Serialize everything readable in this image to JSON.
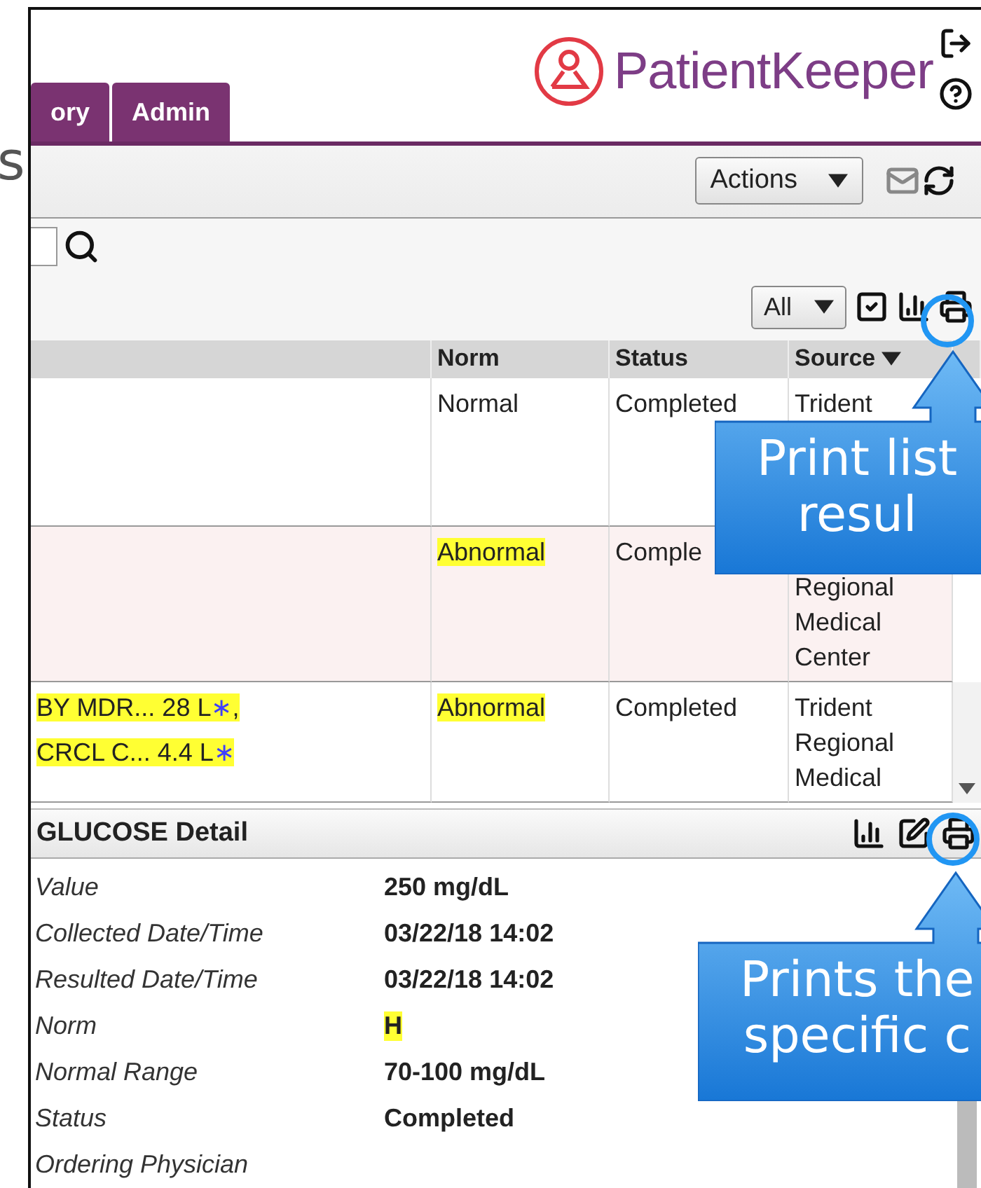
{
  "side_letter": "s",
  "header": {
    "logo": "PatientKeeper",
    "tabs": [
      {
        "label": "ory",
        "selected": false
      },
      {
        "label": "Admin",
        "selected": false
      }
    ]
  },
  "toolbar": {
    "actions": "Actions"
  },
  "filter": {
    "value": "All"
  },
  "table": {
    "columns": [
      {
        "label": "Norm",
        "sorted": false
      },
      {
        "label": "Status",
        "sorted": false
      },
      {
        "label": "Source",
        "sorted": true
      }
    ],
    "rows": [
      {
        "results": [],
        "norm": "Normal",
        "abnormal": false,
        "status": "Completed",
        "source": [
          "Trident"
        ],
        "shaded": false
      },
      {
        "results": [],
        "norm": "Abnormal",
        "abnormal": true,
        "status": "Comple",
        "source": [
          "Regional",
          "Medical",
          "Center"
        ],
        "source_covered": true,
        "shaded": true
      },
      {
        "results": [
          {
            "text": "BY MDR... 28 L",
            "flag": "∗",
            "sep": ","
          },
          {
            "text": "CRCL C... 4.4 L",
            "flag": "∗"
          }
        ],
        "norm": "Abnormal",
        "abnormal": true,
        "status": "Completed",
        "source": [
          "Trident",
          "Regional",
          "Medical"
        ],
        "shaded": false
      }
    ]
  },
  "detail": {
    "title": "GLUCOSE Detail",
    "fields": [
      {
        "label": "Value",
        "value": "250 mg/dL",
        "abnormal": false
      },
      {
        "label": "Collected Date/Time",
        "value": "03/22/18 14:02",
        "abnormal": false
      },
      {
        "label": "Resulted Date/Time",
        "value": "03/22/18 14:02",
        "abnormal": false
      },
      {
        "label": "Norm",
        "value": "H",
        "abnormal": true
      },
      {
        "label": "Normal Range",
        "value": "70-100 mg/dL",
        "abnormal": false
      },
      {
        "label": "Status",
        "value": "Completed",
        "abnormal": false
      },
      {
        "label": "Ordering Physician"
      }
    ]
  },
  "callouts": [
    {
      "lines": [
        "Print list",
        "resul"
      ]
    },
    {
      "lines": [
        "Prints the",
        "specific c"
      ]
    }
  ]
}
